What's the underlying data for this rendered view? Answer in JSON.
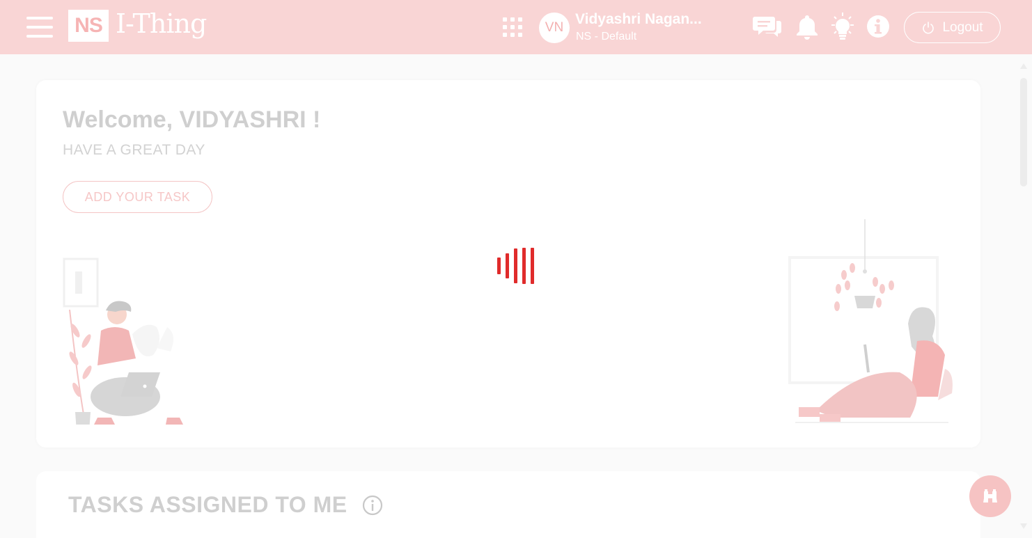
{
  "header": {
    "logo_badge": "NS",
    "logo_text": "I-Thing",
    "user_initials": "VN",
    "user_name": "Vidyashri Nagan...",
    "user_org": "NS - Default",
    "logout_label": "Logout"
  },
  "welcome": {
    "title": "Welcome, VIDYASHRI !",
    "subtitle": "HAVE A GREAT DAY",
    "add_task_label": "ADD YOUR TASK"
  },
  "tasks": {
    "title": "TASKS ASSIGNED TO ME"
  },
  "icons": {
    "menu": "hamburger-icon",
    "apps": "apps-grid-icon",
    "chat": "chat-icon",
    "bell": "bell-icon",
    "bulb": "lightbulb-icon",
    "info": "info-icon",
    "power": "power-icon",
    "binoculars": "binoculars-icon"
  },
  "colors": {
    "header_bg": "#f9d5d5",
    "loader": "#e02b2b",
    "accent": "#f6b4b4"
  }
}
